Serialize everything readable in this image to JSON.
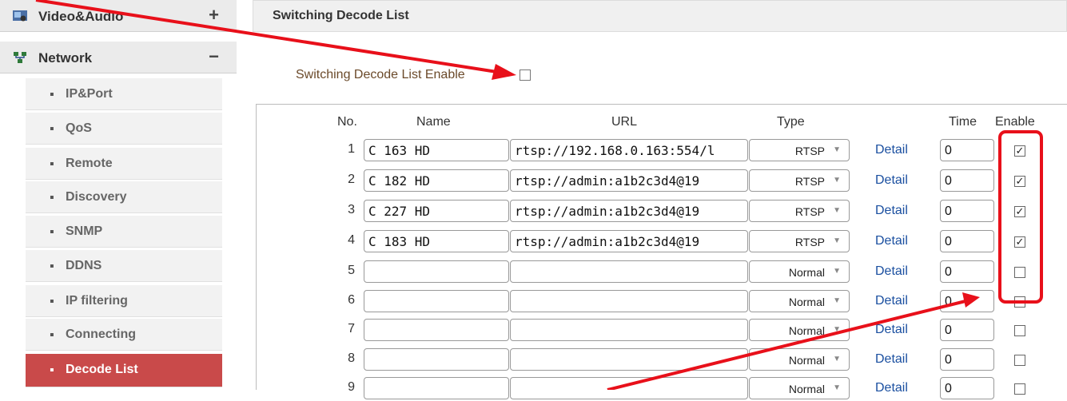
{
  "sidebar": {
    "sections": [
      {
        "label": "Video&Audio",
        "sign": "+"
      },
      {
        "label": "Network",
        "sign": "−"
      }
    ],
    "items": [
      {
        "label": "IP&Port"
      },
      {
        "label": "QoS"
      },
      {
        "label": "Remote"
      },
      {
        "label": "Discovery"
      },
      {
        "label": "SNMP"
      },
      {
        "label": "DDNS"
      },
      {
        "label": "IP filtering"
      },
      {
        "label": "Connecting"
      },
      {
        "label": "Decode List",
        "active": true
      }
    ],
    "bullet": "▪"
  },
  "panel": {
    "title": "Switching Decode List",
    "enable_label": "Switching Decode List Enable",
    "enable_checked": false
  },
  "table": {
    "headers": {
      "no": "No.",
      "name": "Name",
      "url": "URL",
      "type": "Type",
      "time": "Time",
      "enable": "Enable"
    },
    "detail_label": "Detail",
    "rows": [
      {
        "no": "1",
        "name": "C 163 HD",
        "url": "rtsp://192.168.0.163:554/l",
        "type": "RTSP",
        "time": "0",
        "enabled": true
      },
      {
        "no": "2",
        "name": "C 182 HD",
        "url": "rtsp://admin:a1b2c3d4@19",
        "type": "RTSP",
        "time": "0",
        "enabled": true
      },
      {
        "no": "3",
        "name": "C 227 HD",
        "url": "rtsp://admin:a1b2c3d4@19",
        "type": "RTSP",
        "time": "0",
        "enabled": true
      },
      {
        "no": "4",
        "name": "C 183 HD",
        "url": "rtsp://admin:a1b2c3d4@19",
        "type": "RTSP",
        "time": "0",
        "enabled": true
      },
      {
        "no": "5",
        "name": "",
        "url": "",
        "type": "Normal",
        "time": "0",
        "enabled": false
      },
      {
        "no": "6",
        "name": "",
        "url": "",
        "type": "Normal",
        "time": "0",
        "enabled": false
      },
      {
        "no": "7",
        "name": "",
        "url": "",
        "type": "Normal",
        "time": "0",
        "enabled": false
      },
      {
        "no": "8",
        "name": "",
        "url": "",
        "type": "Normal",
        "time": "0",
        "enabled": false
      },
      {
        "no": "9",
        "name": "",
        "url": "",
        "type": "Normal",
        "time": "0",
        "enabled": false
      }
    ]
  },
  "colors": {
    "active_item": "#c94a4a",
    "annotation": "#e8101a",
    "link": "#1a4fa0"
  }
}
